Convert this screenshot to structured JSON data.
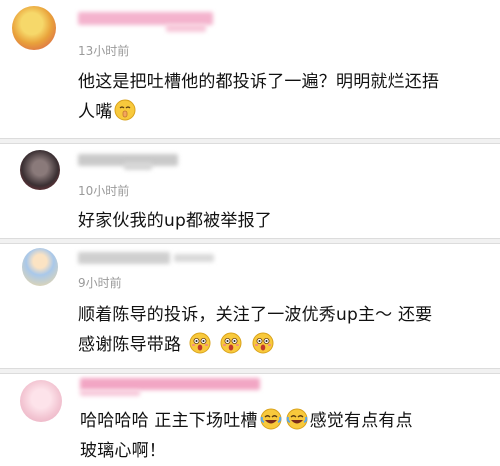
{
  "comments": [
    {
      "time": "13小时前",
      "text_line1": "他这是把吐槽他的都投诉了一遍？明明就烂还捂",
      "text_line2": "人嘴"
    },
    {
      "time": "10小时前",
      "text_line1": "好家伙我的up都被举报了"
    },
    {
      "time": "9小时前",
      "text_line1": "顺着陈导的投诉，关注了一波优秀up主～ 还要",
      "text_line2": "感谢陈导带路"
    },
    {
      "text_part1": "哈哈哈哈  正主下场吐槽",
      "text_part2": "感觉有点有点",
      "text_line2": "玻璃心啊！"
    }
  ],
  "icons": {
    "emoji_1": "shush-face-emoji",
    "emoji_2": "scream-face-emoji",
    "emoji_3": "laugh-cry-emoji"
  },
  "colors": {
    "name_blur_pink": "#f2a6c4",
    "time_gray": "#9a9a9a",
    "divider": "#f1f1f1"
  }
}
